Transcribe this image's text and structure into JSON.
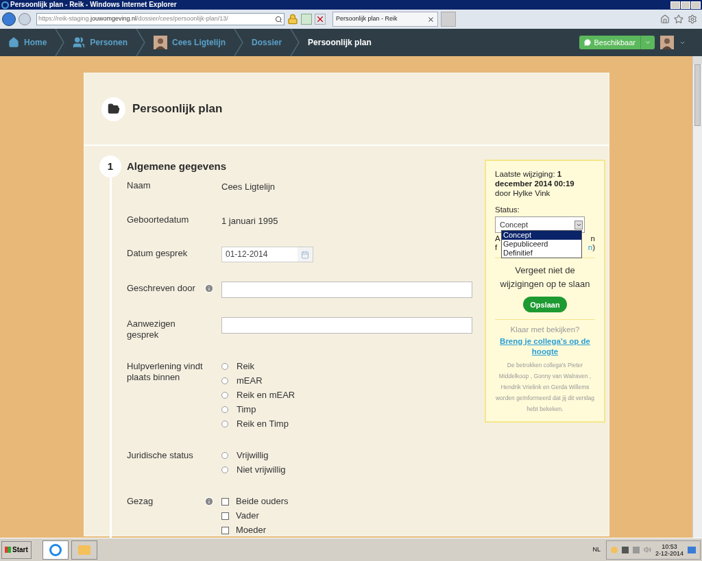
{
  "window": {
    "title": "Persoonlijk plan - Reik - Windows Internet Explorer"
  },
  "browser": {
    "url_prefix": "https://reik-staging.",
    "url_domain": "jouwomgeving.nl",
    "url_path": "/dossier/cees/persoonlijk-plan/13/",
    "tab": "Persoonlijk plan - Reik"
  },
  "breadcrumbs": [
    {
      "label": "Home",
      "kind": "home",
      "selected": false
    },
    {
      "label": "Personen",
      "kind": "people",
      "selected": false
    },
    {
      "label": "Cees Ligtelijn",
      "kind": "person",
      "selected": false
    },
    {
      "label": "Dossier",
      "kind": "plain",
      "selected": false
    },
    {
      "label": "Persoonlijk plan",
      "kind": "plain",
      "selected": true
    }
  ],
  "status_button": "Beschikbaar",
  "page_title": "Persoonlijk plan",
  "section": {
    "number": "1",
    "title": "Algemene gegevens",
    "fields": [
      {
        "kind": "text",
        "label": "Naam",
        "info": false,
        "value": "Cees Ligtelijn"
      },
      {
        "kind": "text",
        "label": "Geboortedatum",
        "info": false,
        "value": "1 januari 1995"
      },
      {
        "kind": "date",
        "label": "Datum gesprek",
        "info": false,
        "value": "01-12-2014"
      },
      {
        "kind": "input",
        "label": "Geschreven door",
        "info": true
      },
      {
        "kind": "input",
        "label": "Aanwezigen gesprek",
        "info": false
      },
      {
        "kind": "radio",
        "label": "Hulpverlening vindt plaats binnen",
        "info": false,
        "options": [
          {
            "label": "Reik",
            "selected": false
          },
          {
            "label": "mEAR",
            "selected": false
          },
          {
            "label": "Reik en mEAR",
            "selected": false
          },
          {
            "label": "Timp",
            "selected": false
          },
          {
            "label": "Reik en Timp",
            "selected": false
          }
        ]
      },
      {
        "kind": "radio",
        "label": "Juridische status",
        "info": false,
        "options": [
          {
            "label": "Vrijwillig",
            "selected": false
          },
          {
            "label": "Niet vrijwillig",
            "selected": false
          }
        ]
      },
      {
        "kind": "checkbox",
        "label": "Gezag",
        "info": true,
        "options": [
          {
            "label": "Beide ouders",
            "checked": false
          },
          {
            "label": "Vader",
            "checked": false
          },
          {
            "label": "Moeder",
            "checked": false
          }
        ]
      }
    ]
  },
  "sidebar": {
    "changed_label": "Laatste wijziging: ",
    "changed_date": "1 december 2014 00:19",
    "changed_by": "door Hylke Vink",
    "status_label": "Status:",
    "status_value": "Concept",
    "status_options": [
      {
        "label": "Concept",
        "selected": true
      },
      {
        "label": "Gepubliceerd",
        "selected": false
      },
      {
        "label": "Definitief",
        "selected": false
      }
    ],
    "covered_lines": [
      {
        "left": "A",
        "right": "n",
        "link": false
      },
      {
        "left": "f",
        "right": "n",
        "link": true,
        "after": ")"
      }
    ],
    "reminder": "Vergeet niet de wijzigingen op te slaan",
    "save": "Opslaan",
    "done_question": "Klaar met bekijken?",
    "notify_link": "Breng je collega's op de hoogte",
    "notify_note": "De betrokken collega's Pieter Middelkoop , Gonny van Walraven , Hendrik Vrielink en Gerda Willems worden geïnformeerd dat jij dit verslag hebt bekeken."
  },
  "taskbar": {
    "start": "Start",
    "language": "NL",
    "time": "10:53",
    "date": "2-12-2014"
  }
}
